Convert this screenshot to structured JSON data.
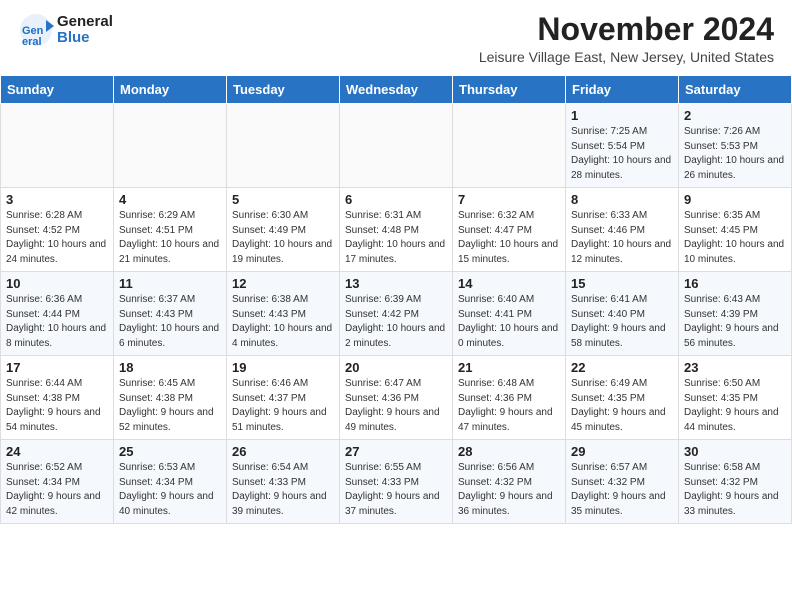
{
  "header": {
    "logo_line1": "General",
    "logo_line2": "Blue",
    "month_title": "November 2024",
    "location": "Leisure Village East, New Jersey, United States"
  },
  "days_of_week": [
    "Sunday",
    "Monday",
    "Tuesday",
    "Wednesday",
    "Thursday",
    "Friday",
    "Saturday"
  ],
  "weeks": [
    [
      {
        "day": "",
        "info": ""
      },
      {
        "day": "",
        "info": ""
      },
      {
        "day": "",
        "info": ""
      },
      {
        "day": "",
        "info": ""
      },
      {
        "day": "",
        "info": ""
      },
      {
        "day": "1",
        "info": "Sunrise: 7:25 AM\nSunset: 5:54 PM\nDaylight: 10 hours and 28 minutes."
      },
      {
        "day": "2",
        "info": "Sunrise: 7:26 AM\nSunset: 5:53 PM\nDaylight: 10 hours and 26 minutes."
      }
    ],
    [
      {
        "day": "3",
        "info": "Sunrise: 6:28 AM\nSunset: 4:52 PM\nDaylight: 10 hours and 24 minutes."
      },
      {
        "day": "4",
        "info": "Sunrise: 6:29 AM\nSunset: 4:51 PM\nDaylight: 10 hours and 21 minutes."
      },
      {
        "day": "5",
        "info": "Sunrise: 6:30 AM\nSunset: 4:49 PM\nDaylight: 10 hours and 19 minutes."
      },
      {
        "day": "6",
        "info": "Sunrise: 6:31 AM\nSunset: 4:48 PM\nDaylight: 10 hours and 17 minutes."
      },
      {
        "day": "7",
        "info": "Sunrise: 6:32 AM\nSunset: 4:47 PM\nDaylight: 10 hours and 15 minutes."
      },
      {
        "day": "8",
        "info": "Sunrise: 6:33 AM\nSunset: 4:46 PM\nDaylight: 10 hours and 12 minutes."
      },
      {
        "day": "9",
        "info": "Sunrise: 6:35 AM\nSunset: 4:45 PM\nDaylight: 10 hours and 10 minutes."
      }
    ],
    [
      {
        "day": "10",
        "info": "Sunrise: 6:36 AM\nSunset: 4:44 PM\nDaylight: 10 hours and 8 minutes."
      },
      {
        "day": "11",
        "info": "Sunrise: 6:37 AM\nSunset: 4:43 PM\nDaylight: 10 hours and 6 minutes."
      },
      {
        "day": "12",
        "info": "Sunrise: 6:38 AM\nSunset: 4:43 PM\nDaylight: 10 hours and 4 minutes."
      },
      {
        "day": "13",
        "info": "Sunrise: 6:39 AM\nSunset: 4:42 PM\nDaylight: 10 hours and 2 minutes."
      },
      {
        "day": "14",
        "info": "Sunrise: 6:40 AM\nSunset: 4:41 PM\nDaylight: 10 hours and 0 minutes."
      },
      {
        "day": "15",
        "info": "Sunrise: 6:41 AM\nSunset: 4:40 PM\nDaylight: 9 hours and 58 minutes."
      },
      {
        "day": "16",
        "info": "Sunrise: 6:43 AM\nSunset: 4:39 PM\nDaylight: 9 hours and 56 minutes."
      }
    ],
    [
      {
        "day": "17",
        "info": "Sunrise: 6:44 AM\nSunset: 4:38 PM\nDaylight: 9 hours and 54 minutes."
      },
      {
        "day": "18",
        "info": "Sunrise: 6:45 AM\nSunset: 4:38 PM\nDaylight: 9 hours and 52 minutes."
      },
      {
        "day": "19",
        "info": "Sunrise: 6:46 AM\nSunset: 4:37 PM\nDaylight: 9 hours and 51 minutes."
      },
      {
        "day": "20",
        "info": "Sunrise: 6:47 AM\nSunset: 4:36 PM\nDaylight: 9 hours and 49 minutes."
      },
      {
        "day": "21",
        "info": "Sunrise: 6:48 AM\nSunset: 4:36 PM\nDaylight: 9 hours and 47 minutes."
      },
      {
        "day": "22",
        "info": "Sunrise: 6:49 AM\nSunset: 4:35 PM\nDaylight: 9 hours and 45 minutes."
      },
      {
        "day": "23",
        "info": "Sunrise: 6:50 AM\nSunset: 4:35 PM\nDaylight: 9 hours and 44 minutes."
      }
    ],
    [
      {
        "day": "24",
        "info": "Sunrise: 6:52 AM\nSunset: 4:34 PM\nDaylight: 9 hours and 42 minutes."
      },
      {
        "day": "25",
        "info": "Sunrise: 6:53 AM\nSunset: 4:34 PM\nDaylight: 9 hours and 40 minutes."
      },
      {
        "day": "26",
        "info": "Sunrise: 6:54 AM\nSunset: 4:33 PM\nDaylight: 9 hours and 39 minutes."
      },
      {
        "day": "27",
        "info": "Sunrise: 6:55 AM\nSunset: 4:33 PM\nDaylight: 9 hours and 37 minutes."
      },
      {
        "day": "28",
        "info": "Sunrise: 6:56 AM\nSunset: 4:32 PM\nDaylight: 9 hours and 36 minutes."
      },
      {
        "day": "29",
        "info": "Sunrise: 6:57 AM\nSunset: 4:32 PM\nDaylight: 9 hours and 35 minutes."
      },
      {
        "day": "30",
        "info": "Sunrise: 6:58 AM\nSunset: 4:32 PM\nDaylight: 9 hours and 33 minutes."
      }
    ]
  ]
}
